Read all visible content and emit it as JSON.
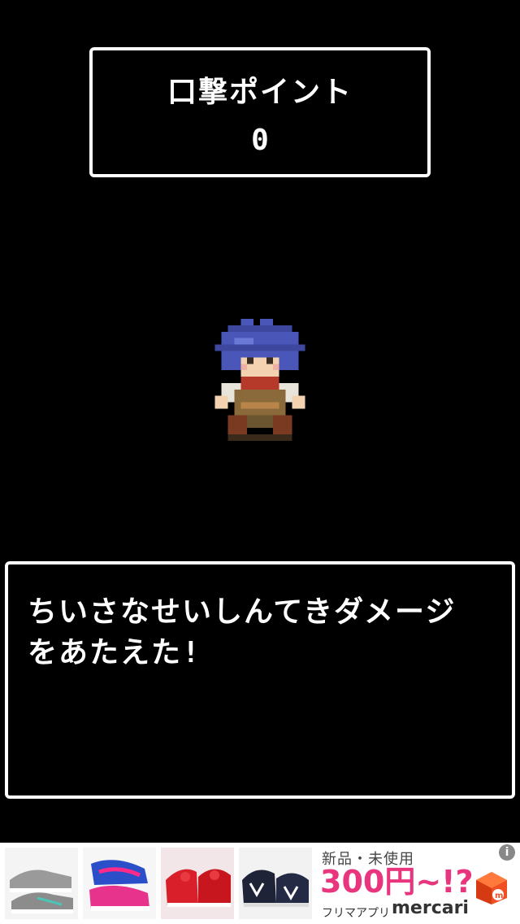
{
  "score": {
    "title": "口撃ポイント",
    "value": "0"
  },
  "dialog": {
    "text": "ちいさなせいしんてきダメージ\nをあたえた!"
  },
  "ad": {
    "new_text": "新品・未使用",
    "price": "300円~!?",
    "sub_text": "フリマアプリ",
    "brand": "mercari",
    "info_icon": "i",
    "thumbnails": [
      {
        "name": "gray-sneakers"
      },
      {
        "name": "pink-blue-sneakers"
      },
      {
        "name": "red-sneakers"
      },
      {
        "name": "navy-sneakers"
      }
    ],
    "colors": {
      "price": "#e8357e",
      "box": "#f04e23"
    }
  }
}
